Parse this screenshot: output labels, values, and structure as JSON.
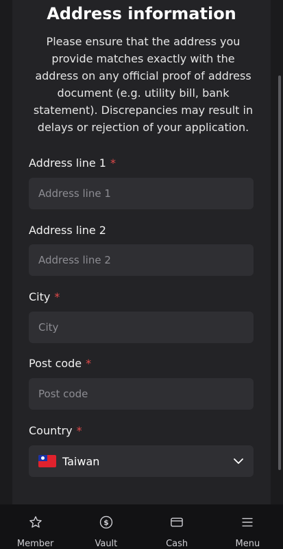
{
  "header": {
    "title": "Address information",
    "description": "Please ensure that the address you provide matches exactly with the address on any official proof of address document (e.g. utility bill, bank statement). Discrepancies may result in delays or rejection of your application."
  },
  "form": {
    "address1": {
      "label": "Address line 1",
      "required_mark": "*",
      "placeholder": "Address line 1",
      "value": ""
    },
    "address2": {
      "label": "Address line 2",
      "placeholder": "Address line 2",
      "value": ""
    },
    "city": {
      "label": "City",
      "required_mark": "*",
      "placeholder": "City",
      "value": ""
    },
    "postcode": {
      "label": "Post code",
      "required_mark": "*",
      "placeholder": "Post code",
      "value": ""
    },
    "country": {
      "label": "Country",
      "required_mark": "*",
      "selected": "Taiwan",
      "flag_icon": "taiwan-flag-icon"
    }
  },
  "bottom_nav": {
    "items": [
      {
        "label": "Member",
        "icon": "star-icon"
      },
      {
        "label": "Vault",
        "icon": "dollar-circle-icon"
      },
      {
        "label": "Cash",
        "icon": "card-icon"
      },
      {
        "label": "Menu",
        "icon": "hamburger-menu-icon"
      }
    ]
  },
  "colors": {
    "background": "#1b1b1d",
    "panel": "#232326",
    "input": "#2f2f33",
    "required": "#e24a4a"
  }
}
